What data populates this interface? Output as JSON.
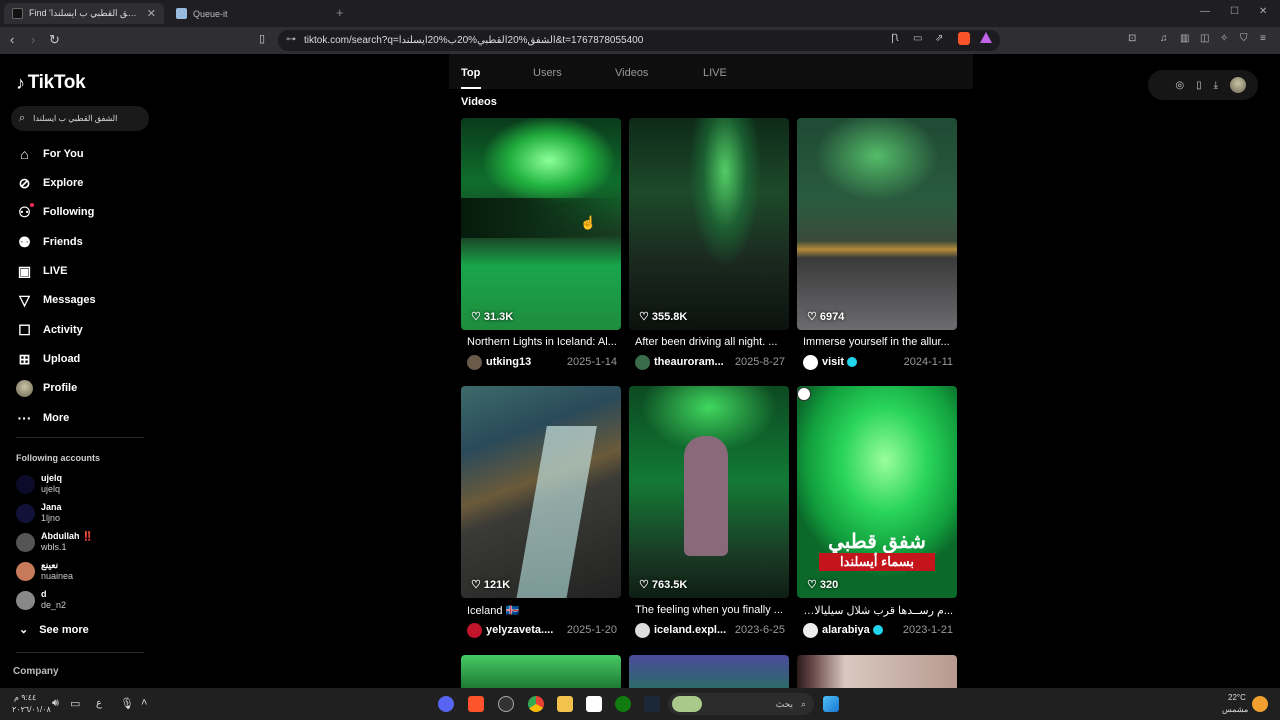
{
  "browser": {
    "tabs": [
      {
        "title": "Find 'الشفق القطبي ب ايسلندا'",
        "active": true
      },
      {
        "title": "Queue-it",
        "active": false
      }
    ],
    "url": "tiktok.com/search?q=الشفق%20القطبي%20ب%20ايسلندا&t=1767878055400"
  },
  "sidebar": {
    "logo": "TikTok",
    "search_value": "الشفق القطبي ب ايسلندا",
    "nav": [
      {
        "label": "For You",
        "icon": "home-icon"
      },
      {
        "label": "Explore",
        "icon": "compass-icon"
      },
      {
        "label": "Following",
        "icon": "following-icon"
      },
      {
        "label": "Friends",
        "icon": "friends-icon"
      },
      {
        "label": "LIVE",
        "icon": "live-icon"
      },
      {
        "label": "Messages",
        "icon": "messages-icon"
      },
      {
        "label": "Activity",
        "icon": "activity-icon"
      },
      {
        "label": "Upload",
        "icon": "upload-icon"
      },
      {
        "label": "Profile",
        "icon": "avatar"
      },
      {
        "label": "More",
        "icon": "more-icon"
      }
    ],
    "following_title": "Following accounts",
    "accounts": [
      {
        "name": "ujelq",
        "handle": "ujelq",
        "color": "#0c0c2a"
      },
      {
        "name": "Jana",
        "handle": "1ljno",
        "color": "#121238"
      },
      {
        "name": "Abdullah ‼️",
        "handle": "wbls.1",
        "color": "#555"
      },
      {
        "name": "نعينع",
        "handle": "nuainea",
        "color": "#c77a5a"
      },
      {
        "name": "d",
        "handle": "de_n2",
        "color": "#888"
      }
    ],
    "see_more": "See more",
    "company": "Company"
  },
  "main": {
    "tabs": [
      "Top",
      "Users",
      "Videos",
      "LIVE"
    ],
    "section_title": "Videos",
    "videos": [
      {
        "likes": "31.3K",
        "caption": "Northern Lights in Iceland: Al...",
        "user": "utking13",
        "date": "2025-1-14",
        "verified": false,
        "avatar": "#6b5a4a"
      },
      {
        "likes": "355.8K",
        "caption": "After been driving all night. ...",
        "user": "theauroram...",
        "date": "2025-8-27",
        "verified": false,
        "avatar": "#3a6b4a"
      },
      {
        "likes": "6974",
        "caption": "Immerse yourself in the allur...",
        "user": "visit",
        "date": "2024-1-11",
        "verified": true,
        "avatar": "#ffffff"
      },
      {
        "likes": "121K",
        "caption": "Iceland 🇮🇸",
        "user": "yelyzaveta....",
        "date": "2025-1-20",
        "verified": false,
        "avatar": "#c0152b"
      },
      {
        "likes": "763.5K",
        "caption": "The feeling when you finally ...",
        "user": "iceland.expl...",
        "date": "2023-6-25",
        "verified": false,
        "avatar": "#dddddd"
      },
      {
        "likes": "320",
        "caption": "...م رســدها قرب شلال سيليالاندزفوس في",
        "user": "alarabiya",
        "date": "2023-1-21",
        "verified": true,
        "avatar": "#eeeeee"
      }
    ],
    "overlay_line1": "شفق قطبي",
    "overlay_line2": "بسماء أيسلندا"
  },
  "taskbar": {
    "search_placeholder": "بحث",
    "lang": "ع",
    "time": "٩:٤٤ م",
    "date": "٢٠٢٦/٠١/٠٨",
    "weather_temp": "22°C",
    "weather_desc": "مشمس"
  }
}
